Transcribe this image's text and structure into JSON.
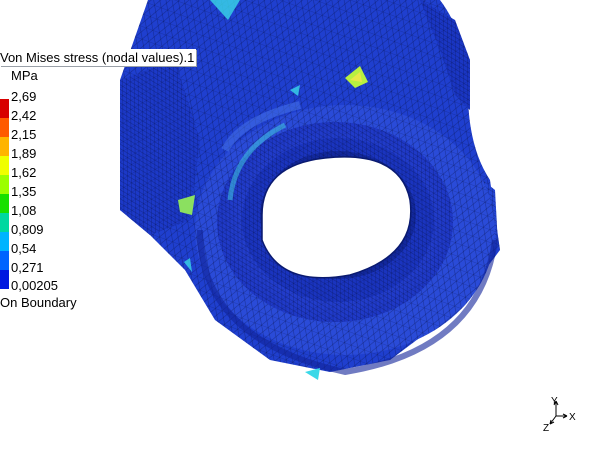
{
  "legend": {
    "title": "Von Mises stress (nodal values).1",
    "unit": "MPa",
    "values": [
      "2,69",
      "2,42",
      "2,15",
      "1,89",
      "1,62",
      "1,35",
      "1,08",
      "0,809",
      "0,54",
      "0,271",
      "0,00205"
    ],
    "footer": "On Boundary",
    "colors": [
      "#d80000",
      "#ff5a00",
      "#ffb400",
      "#f0ff00",
      "#9cff00",
      "#18e000",
      "#00d8a0",
      "#00b4ff",
      "#0064ff",
      "#0018e0"
    ]
  },
  "triad": {
    "labels": [
      "Y",
      "Z",
      "X"
    ]
  },
  "model": {
    "base_color": "#1f3fcf",
    "dark_color": "#10239a",
    "hotspot_colors": [
      "#3ad8e8",
      "#b8f040",
      "#e8e848"
    ]
  }
}
